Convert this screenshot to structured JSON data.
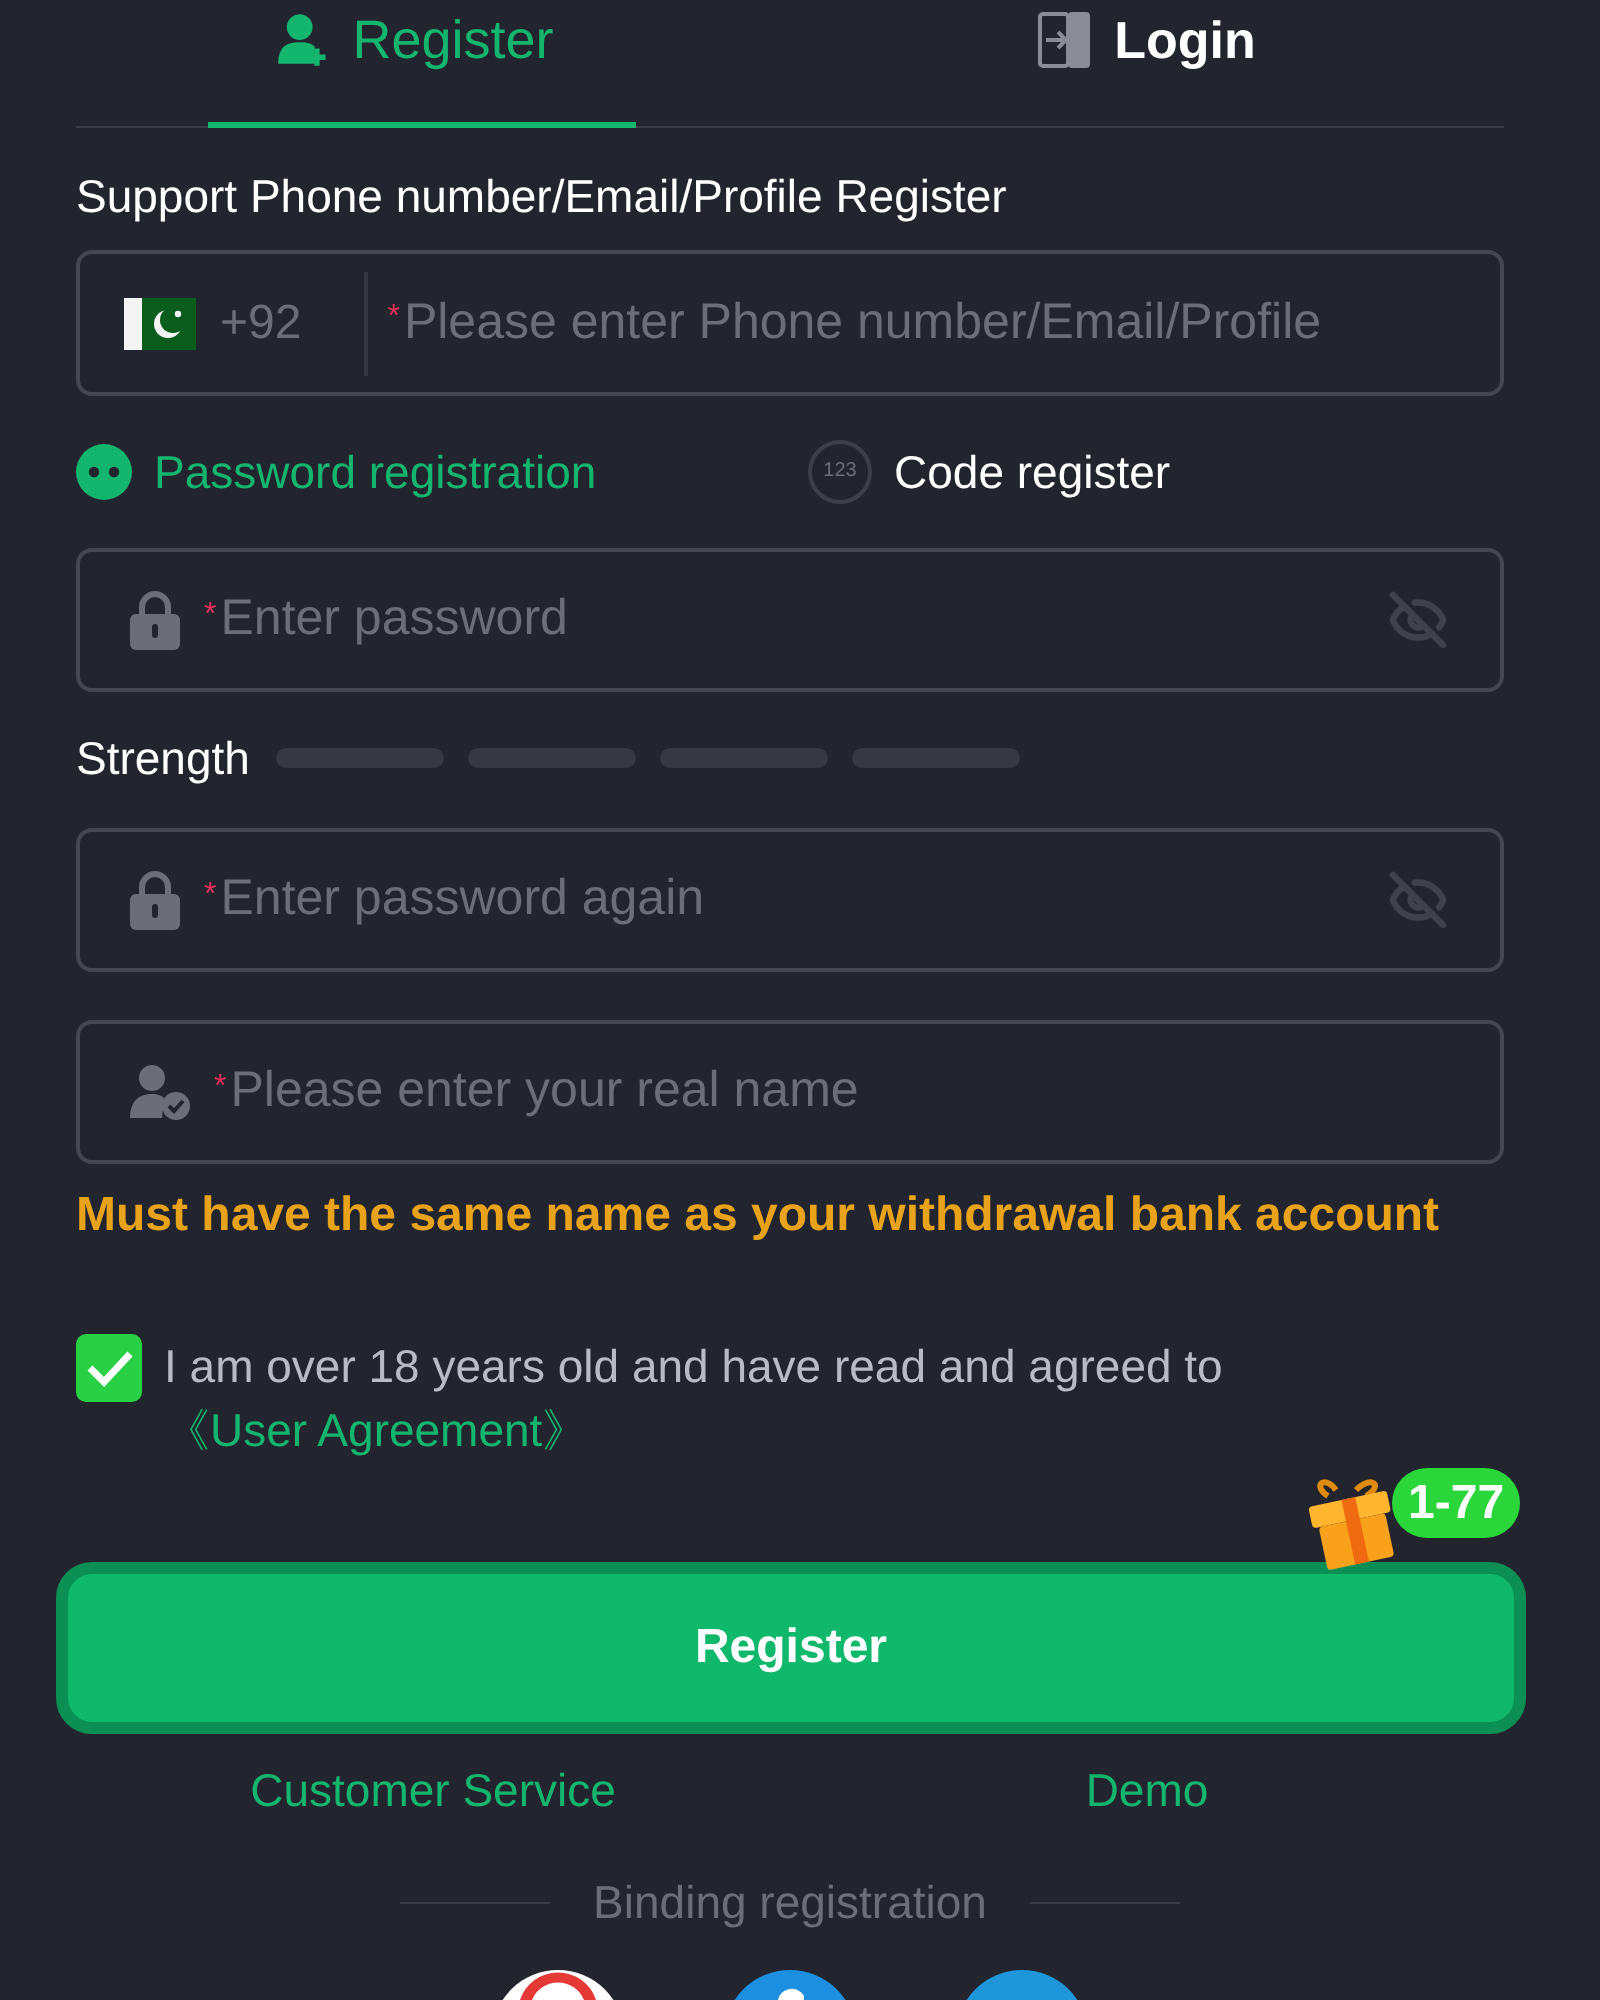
{
  "tabs": [
    {
      "kind": "register",
      "label": "Register",
      "selected": true
    },
    {
      "kind": "login",
      "label": "Login",
      "selected": false
    }
  ],
  "support_label": "Support Phone number/Email/Profile Register",
  "account_field": {
    "country_code": "+92",
    "required_mark": "*",
    "placeholder": "Please enter Phone number/Email/Profile"
  },
  "register_methods": [
    {
      "kind": "password",
      "label": "Password registration",
      "selected": true
    },
    {
      "kind": "code",
      "icon_text": "123",
      "label": "Code register",
      "selected": false
    }
  ],
  "password_field": {
    "required_mark": "*",
    "placeholder": "Enter password",
    "visible": false
  },
  "strength": {
    "label": "Strength",
    "segments": [
      {
        "on": false
      },
      {
        "on": false
      },
      {
        "on": false
      },
      {
        "on": false
      }
    ]
  },
  "confirm_field": {
    "required_mark": "*",
    "placeholder": "Enter password again",
    "visible": false
  },
  "name_field": {
    "required_mark": "*",
    "placeholder": "Please enter your real name"
  },
  "name_warning": "Must have the same name as your withdrawal bank account",
  "agreement": {
    "checked": true,
    "text": "I am over 18 years old and have read and agreed to",
    "link": "《User Agreement》"
  },
  "bonus_badge": "1-77",
  "register_button": "Register",
  "links": [
    "Customer Service",
    "Demo"
  ],
  "binding_label": "Binding registration"
}
